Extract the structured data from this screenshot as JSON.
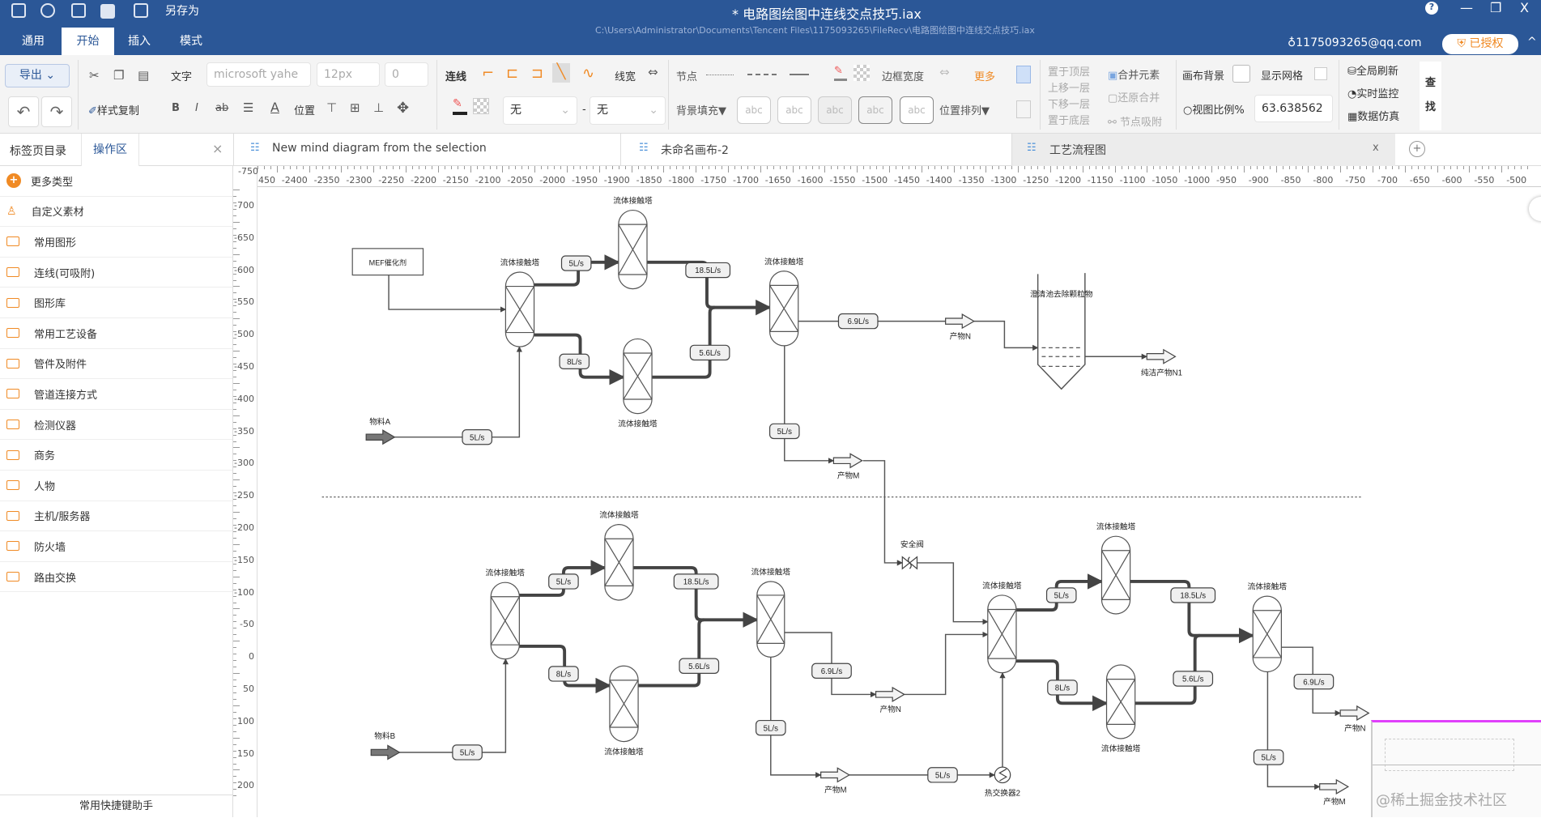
{
  "titlebar": {
    "save_as": "另存为",
    "title": "*  电路图绘图中连线交点技巧.iax",
    "path": "C:\\Users\\Administrator\\Documents\\Tencent Files\\1175093265\\FileRecv\\电路图绘图中连线交点技巧.iax",
    "help": "?",
    "minimize": "—",
    "restore": "❐",
    "close": "X"
  },
  "menu_tabs": [
    "通用",
    "开始",
    "插入",
    "模式"
  ],
  "account": {
    "email": "1175093265@qq.com",
    "license": "已授权",
    "collapse": "^"
  },
  "toolbar": {
    "export": "导出",
    "text_label": "文字",
    "font": "microsoft yahe",
    "font_size": "12px",
    "spacing": "0",
    "connector_label": "连线",
    "line_width": "线宽",
    "node_label": "节点",
    "border_width": "边框宽度",
    "more": "更多",
    "format_copy": "样式复制",
    "bold": "B",
    "italic": "I",
    "strike": "ab",
    "position": "位置",
    "arrow_start": "无",
    "dash": "-",
    "arrow_end": "无",
    "bg_fill": "背景填充▼",
    "abc": [
      "abc",
      "abc",
      "abc",
      "abc",
      "abc"
    ],
    "arrange": "位置排列▼",
    "bring_front": "置于顶层",
    "move_up": "上移一层",
    "move_down": "下移一层",
    "send_back": "置于底层",
    "merge": "合并元素",
    "unmerge": "还原合并",
    "snap": "节点吸附",
    "canvas_bg": "画布背景",
    "show_grid": "显示网格",
    "zoom_label": "视图比例%",
    "zoom_value": "63.638562",
    "refresh": "全局刷新",
    "monitor": "实时监控",
    "simulate": "数据仿真",
    "find": [
      "查",
      "找"
    ],
    "accent": "#f08a24"
  },
  "sidebar": {
    "tabs": [
      "标签页目录",
      "操作区"
    ],
    "close": "×",
    "items": [
      "更多类型",
      "自定义素材",
      "常用图形",
      "连线(可吸附)",
      "图形库",
      "常用工艺设备",
      "管件及附件",
      "管道连接方式",
      "检测仪器",
      "商务",
      "人物",
      "主机/服务器",
      "防火墙",
      "路由交换"
    ],
    "footer": "常用快捷键助手"
  },
  "doc_tabs": [
    {
      "label": "New mind diagram from the selection"
    },
    {
      "label": "未命名画布-2"
    },
    {
      "label": "工艺流程图",
      "active": true,
      "close": "x"
    }
  ],
  "add_tab": "+",
  "ruler": {
    "corner": "-750",
    "top": [
      "-2450",
      "-2400",
      "-2350",
      "-2300",
      "-2250",
      "-2200",
      "-2150",
      "-2100",
      "-2050",
      "-2000",
      "-1950",
      "-1900",
      "-1850",
      "-1800",
      "-1750",
      "-1700",
      "-1650",
      "-1600",
      "-1550",
      "-1500",
      "-1450",
      "-1400",
      "-1350",
      "-1300",
      "-1250",
      "-1200",
      "-1150",
      "-1100",
      "-1050",
      "-1000",
      "-950",
      "-900",
      "-850",
      "-800",
      "-750",
      "-700",
      "-650",
      "-600",
      "-550",
      "-500"
    ],
    "left": [
      "-700",
      "-650",
      "-600",
      "-550",
      "-500",
      "-450",
      "-400",
      "-350",
      "-300",
      "-250",
      "-200",
      "-150",
      "-100",
      "-50",
      "0",
      "50",
      "100",
      "150",
      "200"
    ]
  },
  "diagram": {
    "catalyst": "MEF催化剂",
    "towers": [
      "流体接触塔",
      "流体接触塔",
      "流体接触塔",
      "流体接触塔",
      "流体接触塔",
      "流体接触塔",
      "流体接触塔",
      "流体接触塔",
      "流体接触塔",
      "流体接触塔",
      "流体接触塔",
      "流体接触塔"
    ],
    "flows": [
      "5L/s",
      "18.5L/s",
      "8L/s",
      "5.6L/s",
      "5L/s",
      "6.9L/s",
      "5L/s",
      "5L/s",
      "18.5L/s",
      "8L/s",
      "5.6L/s",
      "5L/s",
      "6.9L/s",
      "5L/s",
      "5L/s",
      "5L/s",
      "18.5L/s",
      "8L/s",
      "5.6L/s",
      "6.9L/s",
      "5L/s"
    ],
    "feeds": [
      "物料A",
      "物料B"
    ],
    "clarifier": "澄清池去除颗粒物",
    "pure_product": "纯洁产物N1",
    "products": [
      "产物N",
      "产物M",
      "产物N",
      "产物M",
      "产物N",
      "产物M"
    ],
    "valve": "安全阀",
    "exchanger": "热交换器2"
  },
  "minimap": {
    "watermark": "@稀土掘金技术社区",
    "border_color": "#e040fb"
  }
}
